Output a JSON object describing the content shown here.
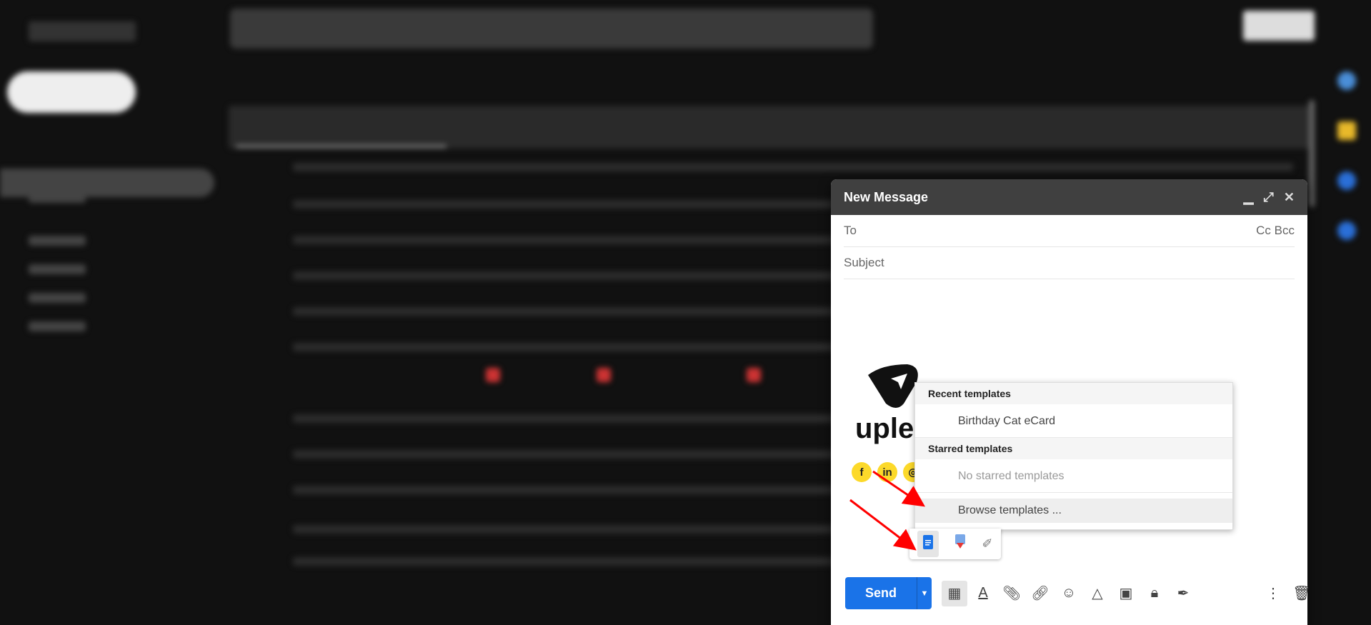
{
  "compose": {
    "title": "New Message",
    "to_label": "To",
    "cc_bcc_label": "Cc Bcc",
    "subject_placeholder": "Subject",
    "signature_logo_text": "uple"
  },
  "templates_menu": {
    "recent_header": "Recent templates",
    "recent_items": [
      "Birthday Cat eCard"
    ],
    "starred_header": "Starred templates",
    "starred_empty": "No starred templates",
    "browse_label": "Browse templates ..."
  },
  "toolbar": {
    "send_label": "Send",
    "icons": [
      "apps-grid-icon",
      "text-format-icon",
      "attach-icon",
      "link-icon",
      "emoji-icon",
      "drive-icon",
      "photo-icon",
      "confidential-icon",
      "signature-pen-icon"
    ]
  },
  "colors": {
    "accent": "#1a73e8",
    "header": "#404040",
    "arrow": "#ff0000",
    "social": "#fcd92a"
  }
}
